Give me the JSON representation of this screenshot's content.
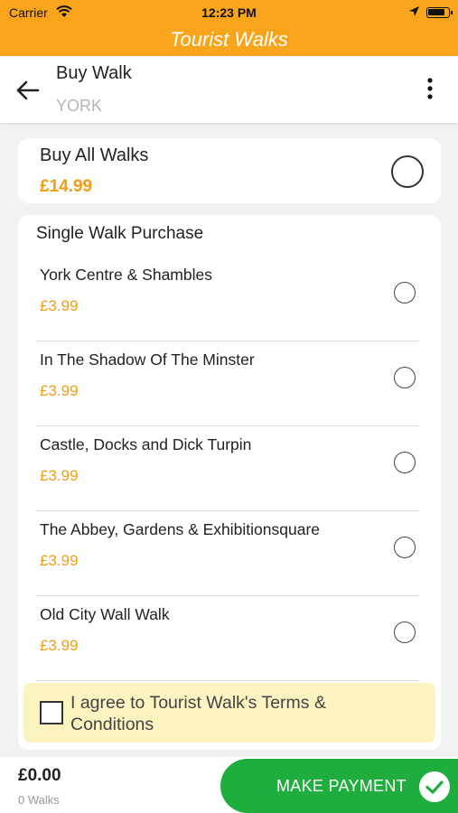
{
  "status_bar": {
    "carrier": "Carrier",
    "time": "12:23 PM",
    "battery_level": 0.85
  },
  "app": {
    "title": "Tourist Walks"
  },
  "toolbar": {
    "title": "Buy Walk",
    "subtitle": "YORK"
  },
  "buy_all": {
    "label": "Buy All Walks",
    "price": "£14.99"
  },
  "single": {
    "title": "Single Walk Purchase",
    "walks": [
      {
        "name": "York Centre & Shambles",
        "price": "£3.99"
      },
      {
        "name": "In The Shadow Of The Minster",
        "price": "£3.99"
      },
      {
        "name": "Castle, Docks and Dick Turpin",
        "price": "£3.99"
      },
      {
        "name": "The Abbey, Gardens & Exhibitionsquare",
        "price": "£3.99"
      },
      {
        "name": "Old City Wall Walk",
        "price": "£3.99"
      }
    ]
  },
  "agreement": {
    "text": "I agree to Tourist Walk's Terms & Conditions"
  },
  "footer": {
    "total": "£0.00",
    "walk_count": "0 Walks",
    "pay_label": "MAKE PAYMENT"
  },
  "colors": {
    "accent": "#f9a51c",
    "price": "#f39c12",
    "pay": "#1fae3e",
    "agree_bg": "#fbf3c0"
  }
}
